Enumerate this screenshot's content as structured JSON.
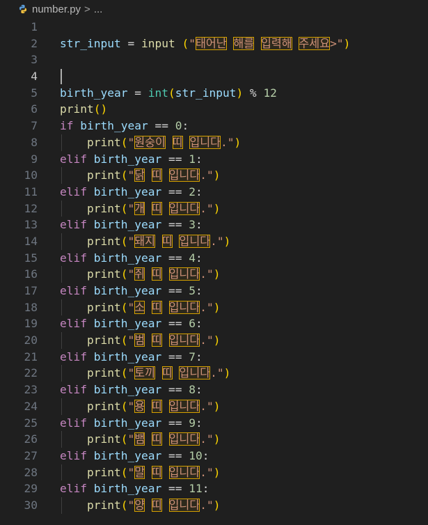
{
  "breadcrumb": {
    "filename": "number.py",
    "separator": ">",
    "rest": "..."
  },
  "editor": {
    "current_line": 4,
    "lines": [
      {
        "n": "1"
      },
      {
        "n": "2"
      },
      {
        "n": "3"
      },
      {
        "n": "4"
      },
      {
        "n": "5"
      },
      {
        "n": "6"
      },
      {
        "n": "7"
      },
      {
        "n": "8"
      },
      {
        "n": "9"
      },
      {
        "n": "10"
      },
      {
        "n": "11"
      },
      {
        "n": "12"
      },
      {
        "n": "13"
      },
      {
        "n": "14"
      },
      {
        "n": "15"
      },
      {
        "n": "16"
      },
      {
        "n": "17"
      },
      {
        "n": "18"
      },
      {
        "n": "19"
      },
      {
        "n": "20"
      },
      {
        "n": "21"
      },
      {
        "n": "22"
      },
      {
        "n": "23"
      },
      {
        "n": "24"
      },
      {
        "n": "25"
      },
      {
        "n": "26"
      },
      {
        "n": "27"
      },
      {
        "n": "28"
      },
      {
        "n": "29"
      },
      {
        "n": "30"
      }
    ]
  },
  "code": {
    "input_var": "str_input",
    "input_fn": "input",
    "input_prompt_open": "\"",
    "input_prompt_words": [
      "태어난",
      "해를",
      "입력해",
      "주세요"
    ],
    "input_prompt_close": ">\"",
    "year_var": "birth_year",
    "int_fn": "int",
    "modulo": "12",
    "print_fn": "print",
    "kw_if": "if",
    "kw_elif": "elif",
    "eq": "==",
    "ttii": "띠",
    "imnida": "입니다",
    "animals": [
      "원숭이",
      "닭",
      "개",
      "돼지",
      "쥐",
      "소",
      "범",
      "토끼",
      "용",
      "뱀",
      "말",
      "양"
    ]
  }
}
